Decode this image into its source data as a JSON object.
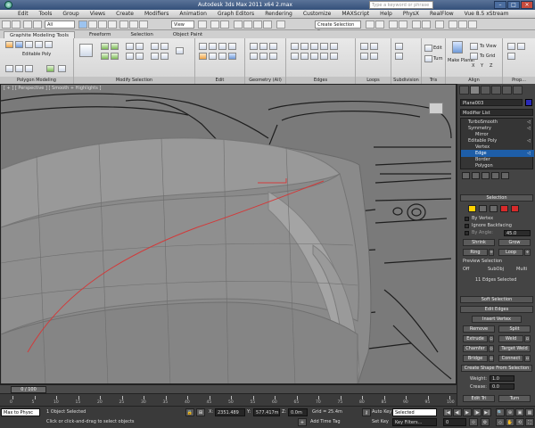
{
  "titlebar": {
    "title": "Autodesk 3ds Max 2011 x64     2.max",
    "search_placeholder": "Type a keyword or phrase"
  },
  "menu": [
    "Edit",
    "Tools",
    "Group",
    "Views",
    "Create",
    "Modifiers",
    "Animation",
    "Graph Editors",
    "Rendering",
    "Customize",
    "MAXScript",
    "Help",
    "PhysX",
    "RealFlow",
    "Vue 8.5 xStream"
  ],
  "quickbar": {
    "selection_filter": "All",
    "reference_coord": "View",
    "named_selection": "Create Selection Se"
  },
  "ribbon": {
    "tabs": [
      "Graphite Modeling Tools",
      "Freeform",
      "Selection",
      "Object Paint"
    ],
    "groups": {
      "polygon_modeling": "Polygon Modeling",
      "modify_selection": "Modify Selection",
      "edit": "Edit",
      "geometry": "Geometry (All)",
      "edges": "Edges",
      "loops": "Loops",
      "subdivision": "Subdivision",
      "tris": "Tris",
      "align": "Align",
      "properties": "Prop..."
    },
    "labels": {
      "editable_poly": "Editable Poly",
      "edit": "Edit",
      "turn": "Turn",
      "make_planar": "Make Planar",
      "to_view": "To View",
      "to_grid": "To Grid",
      "x": "X",
      "y": "Y",
      "z": "Z"
    }
  },
  "viewport": {
    "label": "[ + ] [ Perspective ] [ Smooth + Highlights ]"
  },
  "command_panel": {
    "object_name": "Plane003",
    "modifier_list": "Modifier List",
    "stack": [
      {
        "label": "TurboSmooth",
        "indent": 8,
        "selected": false
      },
      {
        "label": "Symmetry",
        "indent": 8,
        "selected": false
      },
      {
        "label": "Mirror",
        "indent": 16,
        "selected": false
      },
      {
        "label": "Editable Poly",
        "indent": 8,
        "selected": false
      },
      {
        "label": "Vertex",
        "indent": 16,
        "selected": false
      },
      {
        "label": "Edge",
        "indent": 16,
        "selected": true
      },
      {
        "label": "Border",
        "indent": 16,
        "selected": false
      },
      {
        "label": "Polygon",
        "indent": 16,
        "selected": false
      }
    ],
    "selection": {
      "title": "Selection",
      "by_vertex": "By Vertex",
      "ignore_backfacing": "Ignore Backfacing",
      "by_angle": "By Angle:",
      "by_angle_value": "45.0",
      "shrink": "Shrink",
      "grow": "Grow",
      "ring": "Ring",
      "loop": "Loop",
      "preview_selection": "Preview Selection",
      "off": "Off",
      "subobj": "SubObj",
      "multi": "Multi",
      "status": "11 Edges Selected"
    },
    "soft_selection": "Soft Selection",
    "edit_edges": {
      "title": "Edit Edges",
      "insert_vertex": "Insert Vertex",
      "remove": "Remove",
      "split": "Split",
      "extrude": "Extrude",
      "weld": "Weld",
      "chamfer": "Chamfer",
      "target_weld": "Target Weld",
      "bridge": "Bridge",
      "connect": "Connect",
      "create_shape": "Create Shape From Selection",
      "weight_label": "Weight:",
      "weight_value": "1.0",
      "crease_label": "Crease:",
      "crease_value": "0.0",
      "edit_tri": "Edit Tri",
      "turn": "Turn"
    }
  },
  "timeline": {
    "frame": "0 / 100",
    "ticks": [
      "0",
      "5",
      "10",
      "15",
      "20",
      "25",
      "30",
      "35",
      "40",
      "45",
      "50",
      "55",
      "60",
      "65",
      "70",
      "75",
      "80",
      "85",
      "90",
      "95",
      "100"
    ]
  },
  "status": {
    "maxscript": "Max to Physc",
    "objects_selected": "1 Object Selected",
    "prompt": "Click or click-and-drag to select objects",
    "x_label": "X:",
    "x_value": "2351.489",
    "y_label": "Y:",
    "y_value": "577.417m",
    "z_label": "Z:",
    "z_value": "0.0m",
    "grid": "Grid = 25.4m",
    "add_time_tag": "Add Time Tag",
    "auto_key": "Auto Key",
    "set_key": "Set Key",
    "selected_dropdown": "Selected",
    "key_filters": "Key Filters...",
    "frame_value": "0"
  },
  "colors": {
    "selected_edge": "#d23a3a",
    "stack_selected": "#1e5ea8"
  }
}
